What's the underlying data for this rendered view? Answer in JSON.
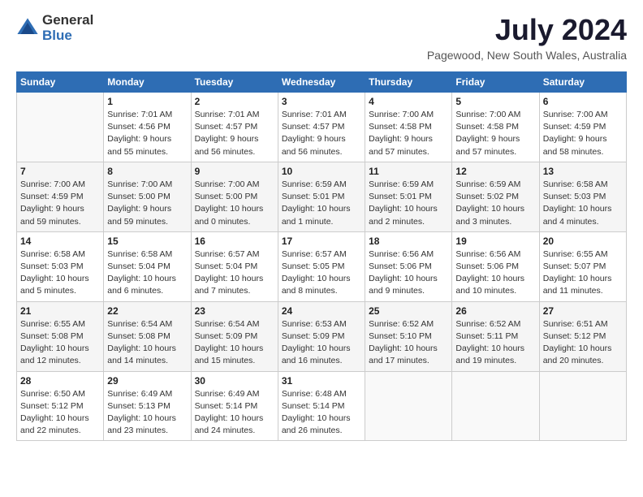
{
  "logo": {
    "text_general": "General",
    "text_blue": "Blue"
  },
  "title": {
    "month_year": "July 2024",
    "location": "Pagewood, New South Wales, Australia"
  },
  "calendar": {
    "headers": [
      "Sunday",
      "Monday",
      "Tuesday",
      "Wednesday",
      "Thursday",
      "Friday",
      "Saturday"
    ],
    "weeks": [
      [
        {
          "day": "",
          "info": ""
        },
        {
          "day": "1",
          "info": "Sunrise: 7:01 AM\nSunset: 4:56 PM\nDaylight: 9 hours\nand 55 minutes."
        },
        {
          "day": "2",
          "info": "Sunrise: 7:01 AM\nSunset: 4:57 PM\nDaylight: 9 hours\nand 56 minutes."
        },
        {
          "day": "3",
          "info": "Sunrise: 7:01 AM\nSunset: 4:57 PM\nDaylight: 9 hours\nand 56 minutes."
        },
        {
          "day": "4",
          "info": "Sunrise: 7:00 AM\nSunset: 4:58 PM\nDaylight: 9 hours\nand 57 minutes."
        },
        {
          "day": "5",
          "info": "Sunrise: 7:00 AM\nSunset: 4:58 PM\nDaylight: 9 hours\nand 57 minutes."
        },
        {
          "day": "6",
          "info": "Sunrise: 7:00 AM\nSunset: 4:59 PM\nDaylight: 9 hours\nand 58 minutes."
        }
      ],
      [
        {
          "day": "7",
          "info": "Sunrise: 7:00 AM\nSunset: 4:59 PM\nDaylight: 9 hours\nand 59 minutes."
        },
        {
          "day": "8",
          "info": "Sunrise: 7:00 AM\nSunset: 5:00 PM\nDaylight: 9 hours\nand 59 minutes."
        },
        {
          "day": "9",
          "info": "Sunrise: 7:00 AM\nSunset: 5:00 PM\nDaylight: 10 hours\nand 0 minutes."
        },
        {
          "day": "10",
          "info": "Sunrise: 6:59 AM\nSunset: 5:01 PM\nDaylight: 10 hours\nand 1 minute."
        },
        {
          "day": "11",
          "info": "Sunrise: 6:59 AM\nSunset: 5:01 PM\nDaylight: 10 hours\nand 2 minutes."
        },
        {
          "day": "12",
          "info": "Sunrise: 6:59 AM\nSunset: 5:02 PM\nDaylight: 10 hours\nand 3 minutes."
        },
        {
          "day": "13",
          "info": "Sunrise: 6:58 AM\nSunset: 5:03 PM\nDaylight: 10 hours\nand 4 minutes."
        }
      ],
      [
        {
          "day": "14",
          "info": "Sunrise: 6:58 AM\nSunset: 5:03 PM\nDaylight: 10 hours\nand 5 minutes."
        },
        {
          "day": "15",
          "info": "Sunrise: 6:58 AM\nSunset: 5:04 PM\nDaylight: 10 hours\nand 6 minutes."
        },
        {
          "day": "16",
          "info": "Sunrise: 6:57 AM\nSunset: 5:04 PM\nDaylight: 10 hours\nand 7 minutes."
        },
        {
          "day": "17",
          "info": "Sunrise: 6:57 AM\nSunset: 5:05 PM\nDaylight: 10 hours\nand 8 minutes."
        },
        {
          "day": "18",
          "info": "Sunrise: 6:56 AM\nSunset: 5:06 PM\nDaylight: 10 hours\nand 9 minutes."
        },
        {
          "day": "19",
          "info": "Sunrise: 6:56 AM\nSunset: 5:06 PM\nDaylight: 10 hours\nand 10 minutes."
        },
        {
          "day": "20",
          "info": "Sunrise: 6:55 AM\nSunset: 5:07 PM\nDaylight: 10 hours\nand 11 minutes."
        }
      ],
      [
        {
          "day": "21",
          "info": "Sunrise: 6:55 AM\nSunset: 5:08 PM\nDaylight: 10 hours\nand 12 minutes."
        },
        {
          "day": "22",
          "info": "Sunrise: 6:54 AM\nSunset: 5:08 PM\nDaylight: 10 hours\nand 14 minutes."
        },
        {
          "day": "23",
          "info": "Sunrise: 6:54 AM\nSunset: 5:09 PM\nDaylight: 10 hours\nand 15 minutes."
        },
        {
          "day": "24",
          "info": "Sunrise: 6:53 AM\nSunset: 5:09 PM\nDaylight: 10 hours\nand 16 minutes."
        },
        {
          "day": "25",
          "info": "Sunrise: 6:52 AM\nSunset: 5:10 PM\nDaylight: 10 hours\nand 17 minutes."
        },
        {
          "day": "26",
          "info": "Sunrise: 6:52 AM\nSunset: 5:11 PM\nDaylight: 10 hours\nand 19 minutes."
        },
        {
          "day": "27",
          "info": "Sunrise: 6:51 AM\nSunset: 5:12 PM\nDaylight: 10 hours\nand 20 minutes."
        }
      ],
      [
        {
          "day": "28",
          "info": "Sunrise: 6:50 AM\nSunset: 5:12 PM\nDaylight: 10 hours\nand 22 minutes."
        },
        {
          "day": "29",
          "info": "Sunrise: 6:49 AM\nSunset: 5:13 PM\nDaylight: 10 hours\nand 23 minutes."
        },
        {
          "day": "30",
          "info": "Sunrise: 6:49 AM\nSunset: 5:14 PM\nDaylight: 10 hours\nand 24 minutes."
        },
        {
          "day": "31",
          "info": "Sunrise: 6:48 AM\nSunset: 5:14 PM\nDaylight: 10 hours\nand 26 minutes."
        },
        {
          "day": "",
          "info": ""
        },
        {
          "day": "",
          "info": ""
        },
        {
          "day": "",
          "info": ""
        }
      ]
    ]
  }
}
